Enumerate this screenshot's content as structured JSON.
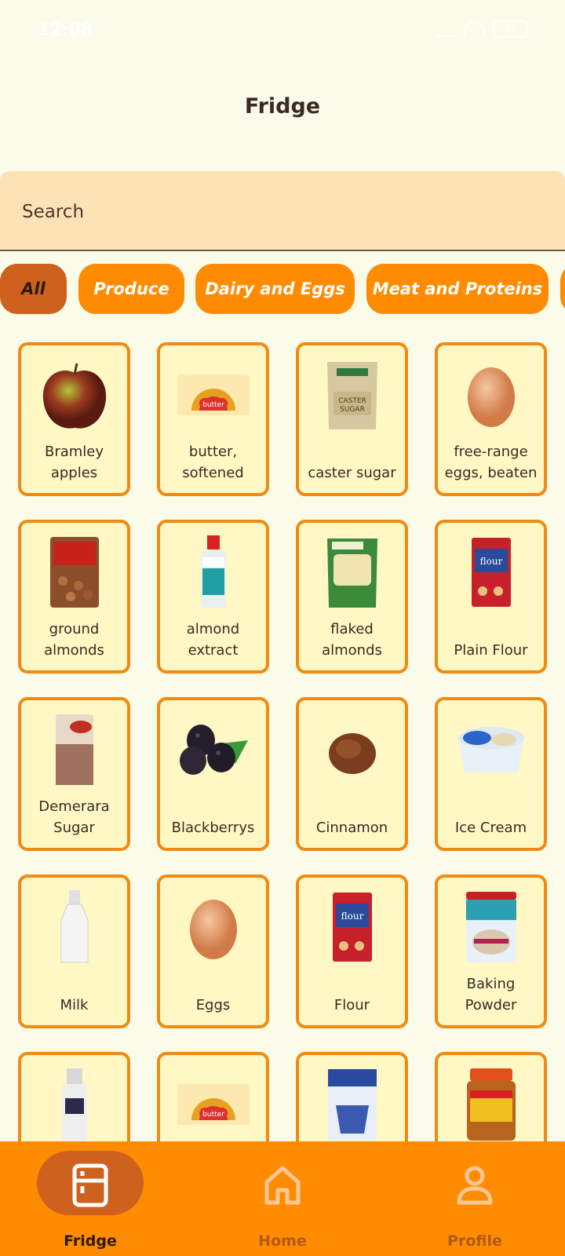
{
  "status_bar": {
    "time": "12:08",
    "battery": "39"
  },
  "header": {
    "title": "Fridge"
  },
  "search": {
    "placeholder": "Search"
  },
  "categories": [
    {
      "label": "All",
      "active": true
    },
    {
      "label": "Produce",
      "active": false
    },
    {
      "label": "Dairy and Eggs",
      "active": false
    },
    {
      "label": "Meat and Proteins",
      "active": false
    }
  ],
  "items": [
    {
      "label": "Bramley apples",
      "icon": "apple-icon"
    },
    {
      "label": "butter, softened",
      "icon": "butter-icon"
    },
    {
      "label": "caster sugar",
      "icon": "sugar-bag-icon"
    },
    {
      "label": "free-range eggs, beaten",
      "icon": "egg-icon"
    },
    {
      "label": "ground almonds",
      "icon": "almond-bag-icon"
    },
    {
      "label": "almond extract",
      "icon": "extract-bottle-icon"
    },
    {
      "label": "flaked almonds",
      "icon": "flaked-almond-bag-icon"
    },
    {
      "label": "Plain Flour",
      "icon": "flour-bag-icon"
    },
    {
      "label": "Demerara Sugar",
      "icon": "demerara-bag-icon"
    },
    {
      "label": "Blackberrys",
      "icon": "blackberry-icon"
    },
    {
      "label": "Cinnamon",
      "icon": "cinnamon-powder-icon"
    },
    {
      "label": "Ice Cream",
      "icon": "ice-cream-tub-icon"
    },
    {
      "label": "Milk",
      "icon": "milk-bottle-icon"
    },
    {
      "label": "Eggs",
      "icon": "egg-icon"
    },
    {
      "label": "Flour",
      "icon": "flour-bag-icon"
    },
    {
      "label": "Baking Powder",
      "icon": "baking-powder-tin-icon"
    },
    {
      "label": "",
      "icon": "salt-grinder-icon"
    },
    {
      "label": "",
      "icon": "butter-icon"
    },
    {
      "label": "",
      "icon": "granulated-sugar-bag-icon"
    },
    {
      "label": "",
      "icon": "peanut-butter-jar-icon"
    }
  ],
  "bottom_nav": [
    {
      "label": "Fridge",
      "icon": "fridge-icon",
      "active": true
    },
    {
      "label": "Home",
      "icon": "home-icon",
      "active": false
    },
    {
      "label": "Profile",
      "icon": "profile-icon",
      "active": false
    }
  ],
  "colors": {
    "background": "#fbfbea",
    "accent": "#ff8c00",
    "active": "#cf611f",
    "card": "#fff8c4"
  }
}
